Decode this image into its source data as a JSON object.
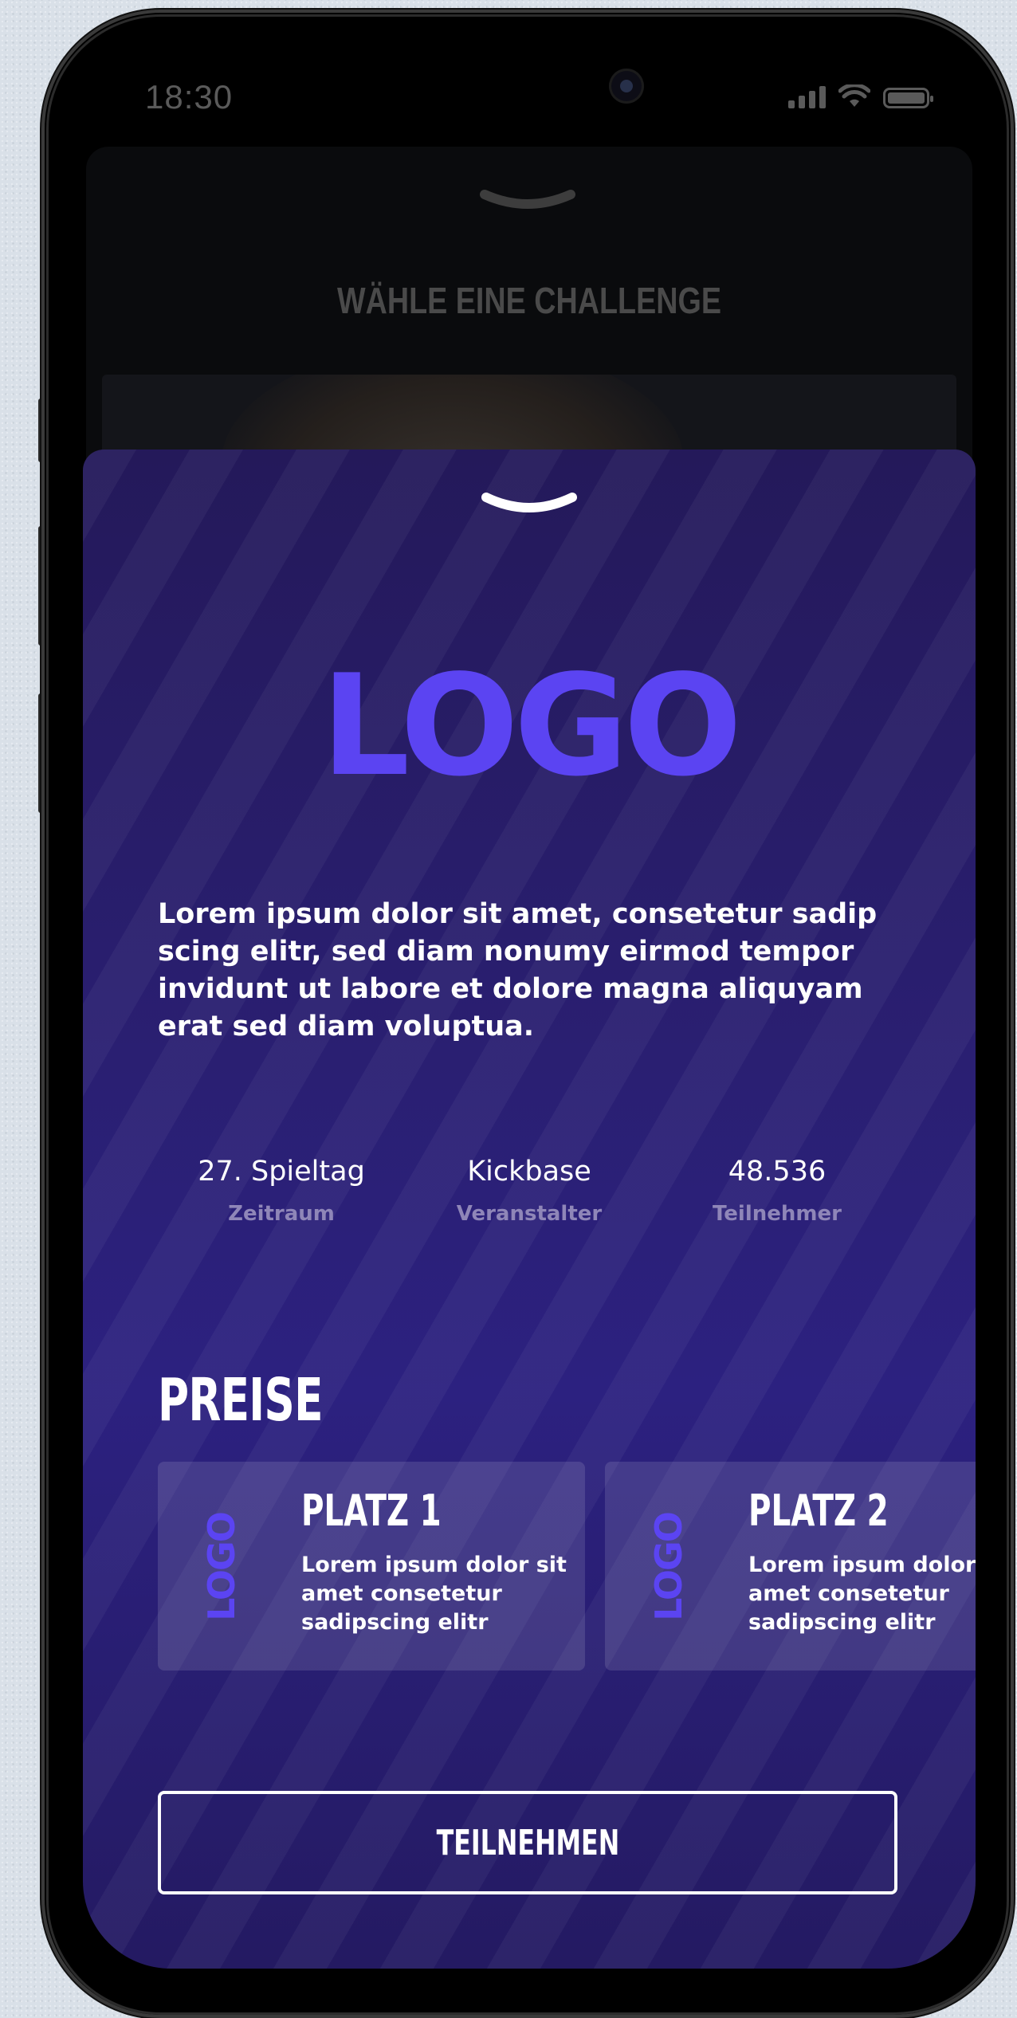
{
  "status_bar": {
    "time": "18:30",
    "icons": [
      "cellular-signal-icon",
      "wifi-icon",
      "battery-icon"
    ]
  },
  "background_sheet": {
    "title": "WÄHLE EINE CHALLENGE",
    "handle_icon": "chevron-down-icon"
  },
  "challenge_sheet": {
    "handle_icon": "chevron-down-icon",
    "logo_text": "LOGO",
    "description": "Lorem ipsum dolor sit amet, consetetur sadip scing elitr, sed diam nonumy eirmod tempor invidunt ut labore et dolore magna aliquyam erat sed diam voluptua.",
    "stats": [
      {
        "value": "27. Spieltag",
        "label": "Zeitraum"
      },
      {
        "value": "Kickbase",
        "label": "Veranstalter"
      },
      {
        "value": "48.536",
        "label": "Teilnehmer"
      }
    ],
    "prizes_heading": "PREISE",
    "prizes": [
      {
        "logo_text": "LOGO",
        "title": "PLATZ 1",
        "text": "Lorem ipsum dolor sit amet consetetur sadipscing elitr"
      },
      {
        "logo_text": "LOGO",
        "title": "PLATZ 2",
        "text": "Lorem ipsum dolor sit amet consetetur sadipscing elitr"
      }
    ],
    "join_button_label": "TEILNEHMEN"
  },
  "colors": {
    "accent": "#5b44f2",
    "sheet_background": "#2a1f72",
    "muted_label": "#8f86b8"
  }
}
